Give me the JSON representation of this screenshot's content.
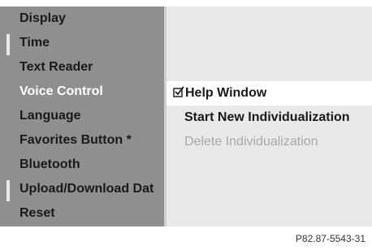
{
  "left_menu": {
    "items": [
      {
        "label": "Display"
      },
      {
        "label": "Time"
      },
      {
        "label": "Text Reader"
      },
      {
        "label": "Voice Control",
        "selected": true
      },
      {
        "label": "Language"
      },
      {
        "label": "Favorites Button *"
      },
      {
        "label": "Bluetooth"
      },
      {
        "label": "Upload/Download Dat"
      },
      {
        "label": "Reset"
      }
    ]
  },
  "right_menu": {
    "items": [
      {
        "label": "Help Window",
        "checked": true,
        "highlighted": true,
        "icon": "checkbox-checked-icon"
      },
      {
        "label": "Start New Individualization"
      },
      {
        "label": "Delete Individualization",
        "disabled": true
      }
    ]
  },
  "footer": {
    "figure_code": "P82.87-5543-31"
  },
  "colors": {
    "left_panel": "#8f8f8f",
    "right_panel": "#e9e9e9",
    "highlight": "#ffffff",
    "selected_text": "#ffffff",
    "disabled_text": "#a8a8a8"
  }
}
